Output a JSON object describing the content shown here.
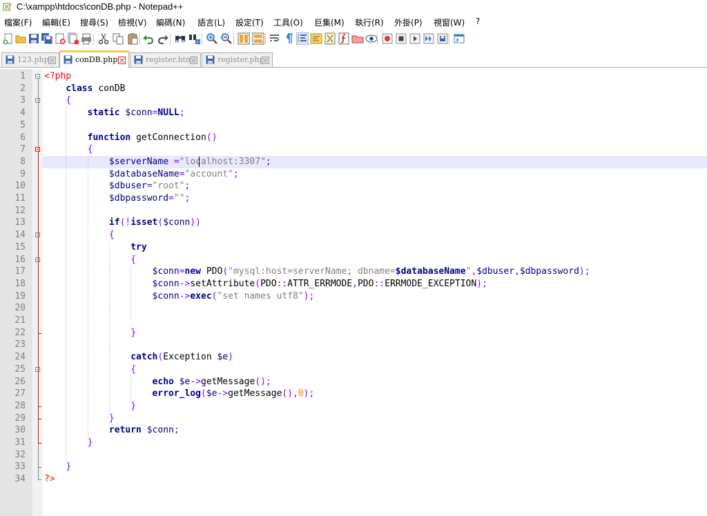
{
  "window": {
    "title": "C:\\xampp\\htdocs\\conDB.php - Notepad++"
  },
  "menu": [
    "檔案(F)",
    "編輯(E)",
    "搜尋(S)",
    "檢視(V)",
    "編碼(N)",
    "語言(L)",
    "設定(T)",
    "工具(O)",
    "巨集(M)",
    "執行(R)",
    "外掛(P)",
    "視窗(W)",
    "?"
  ],
  "toolbar": {
    "buttons": [
      "new-file",
      "open-file",
      "save",
      "save-all",
      "close",
      "close-all",
      "print",
      "cut",
      "copy",
      "paste",
      "undo",
      "redo",
      "find",
      "replace",
      "zoom-in",
      "zoom-out",
      "sync-vertical",
      "sync-horizontal",
      "word-wrap",
      "show-all-characters",
      "indent-guide",
      "user-defined-language",
      "document-map",
      "function-list",
      "folder-as-workspace",
      "monitoring",
      "record-macro",
      "stop-recording",
      "playback-macro",
      "run-macro-multiple",
      "save-macro",
      "run"
    ]
  },
  "tabs": [
    {
      "label": "123.php",
      "active": false
    },
    {
      "label": "conDB.php",
      "active": true
    },
    {
      "label": "register.html",
      "active": false
    },
    {
      "label": "register.php",
      "active": false
    }
  ],
  "editor": {
    "current_line": 8,
    "colors": {
      "keyword": "#00008b",
      "variable": "#000080",
      "string": "#808080",
      "php_tag": "#ff0000",
      "operator": "#8000ff",
      "number": "#ff8000",
      "current_line_bg": "#e8e8ff",
      "gutter_bg": "#e4e4e4"
    },
    "lines": [
      {
        "n": "1",
        "segs": [
          [
            "php",
            "<?php"
          ]
        ]
      },
      {
        "n": "2",
        "segs": [
          [
            "t",
            "    "
          ],
          [
            "kw",
            "class"
          ],
          [
            "t",
            " conDB"
          ]
        ]
      },
      {
        "n": "3",
        "segs": [
          [
            "t",
            "    "
          ],
          [
            "op",
            "{"
          ]
        ]
      },
      {
        "n": "4",
        "segs": [
          [
            "t",
            "        "
          ],
          [
            "kw",
            "static"
          ],
          [
            "t",
            " "
          ],
          [
            "var",
            "$conn"
          ],
          [
            "op",
            "="
          ],
          [
            "kw",
            "NULL"
          ],
          [
            "op",
            ";"
          ]
        ]
      },
      {
        "n": "5",
        "segs": []
      },
      {
        "n": "6",
        "segs": [
          [
            "t",
            "        "
          ],
          [
            "kw",
            "function"
          ],
          [
            "t",
            " getConnection"
          ],
          [
            "op",
            "()"
          ]
        ]
      },
      {
        "n": "7",
        "segs": [
          [
            "t",
            "        "
          ],
          [
            "op",
            "{"
          ]
        ]
      },
      {
        "n": "8",
        "segs": [
          [
            "t",
            "            "
          ],
          [
            "var",
            "$serverName"
          ],
          [
            "t",
            " "
          ],
          [
            "op",
            "="
          ],
          [
            "str",
            "\"localhost:3307\""
          ],
          [
            "op",
            ";"
          ]
        ]
      },
      {
        "n": "9",
        "segs": [
          [
            "t",
            "            "
          ],
          [
            "var",
            "$databaseName"
          ],
          [
            "op",
            "="
          ],
          [
            "str",
            "\"account\""
          ],
          [
            "op",
            ";"
          ]
        ]
      },
      {
        "n": "10",
        "segs": [
          [
            "t",
            "            "
          ],
          [
            "var",
            "$dbuser"
          ],
          [
            "op",
            "="
          ],
          [
            "str",
            "\"root\""
          ],
          [
            "op",
            ";"
          ]
        ]
      },
      {
        "n": "11",
        "segs": [
          [
            "t",
            "            "
          ],
          [
            "var",
            "$dbpassword"
          ],
          [
            "op",
            "="
          ],
          [
            "str",
            "\"\""
          ],
          [
            "op",
            ";"
          ]
        ]
      },
      {
        "n": "12",
        "segs": []
      },
      {
        "n": "13",
        "segs": [
          [
            "t",
            "            "
          ],
          [
            "kw",
            "if"
          ],
          [
            "op",
            "(!"
          ],
          [
            "kw",
            "isset"
          ],
          [
            "op",
            "("
          ],
          [
            "var",
            "$conn"
          ],
          [
            "op",
            "))"
          ]
        ]
      },
      {
        "n": "14",
        "segs": [
          [
            "t",
            "            "
          ],
          [
            "op",
            "{"
          ]
        ]
      },
      {
        "n": "15",
        "segs": [
          [
            "t",
            "                "
          ],
          [
            "kw",
            "try"
          ]
        ]
      },
      {
        "n": "16",
        "segs": [
          [
            "t",
            "                "
          ],
          [
            "op",
            "{"
          ]
        ]
      },
      {
        "n": "17",
        "segs": [
          [
            "t",
            "                    "
          ],
          [
            "var",
            "$conn"
          ],
          [
            "op",
            "="
          ],
          [
            "kw",
            "new"
          ],
          [
            "t",
            " PDO"
          ],
          [
            "op",
            "("
          ],
          [
            "str",
            "\"mysql:host=serverName; dbname="
          ],
          [
            "dqb",
            "$databaseName"
          ],
          [
            "str",
            "\""
          ],
          [
            "op",
            ","
          ],
          [
            "var",
            "$dbuser"
          ],
          [
            "op",
            ","
          ],
          [
            "var",
            "$dbpassword"
          ],
          [
            "op",
            ");"
          ]
        ]
      },
      {
        "n": "18",
        "segs": [
          [
            "t",
            "                    "
          ],
          [
            "var",
            "$conn"
          ],
          [
            "op",
            "->"
          ],
          [
            "t",
            "setAttribute"
          ],
          [
            "op",
            "("
          ],
          [
            "t",
            "PDO"
          ],
          [
            "op",
            "::"
          ],
          [
            "t",
            "ATTR_ERRMODE"
          ],
          [
            "op",
            ","
          ],
          [
            "t",
            "PDO"
          ],
          [
            "op",
            "::"
          ],
          [
            "t",
            "ERRMODE_EXCEPTION"
          ],
          [
            "op",
            ");"
          ]
        ]
      },
      {
        "n": "19",
        "segs": [
          [
            "t",
            "                    "
          ],
          [
            "var",
            "$conn"
          ],
          [
            "op",
            "->"
          ],
          [
            "kw",
            "exec"
          ],
          [
            "op",
            "("
          ],
          [
            "str",
            "\"set names utf8\""
          ],
          [
            "op",
            ");"
          ]
        ]
      },
      {
        "n": "20",
        "segs": []
      },
      {
        "n": "21",
        "segs": []
      },
      {
        "n": "22",
        "segs": [
          [
            "t",
            "                "
          ],
          [
            "op",
            "}"
          ]
        ]
      },
      {
        "n": "23",
        "segs": []
      },
      {
        "n": "24",
        "segs": [
          [
            "t",
            "                "
          ],
          [
            "kw",
            "catch"
          ],
          [
            "op",
            "("
          ],
          [
            "t",
            "Exception "
          ],
          [
            "var",
            "$e"
          ],
          [
            "op",
            ")"
          ]
        ]
      },
      {
        "n": "25",
        "segs": [
          [
            "t",
            "                "
          ],
          [
            "op",
            "{"
          ]
        ]
      },
      {
        "n": "26",
        "segs": [
          [
            "t",
            "                    "
          ],
          [
            "kw",
            "echo"
          ],
          [
            "t",
            " "
          ],
          [
            "var",
            "$e"
          ],
          [
            "op",
            "->"
          ],
          [
            "t",
            "getMessage"
          ],
          [
            "op",
            "();"
          ]
        ]
      },
      {
        "n": "27",
        "segs": [
          [
            "t",
            "                    "
          ],
          [
            "kw",
            "error_log"
          ],
          [
            "op",
            "("
          ],
          [
            "var",
            "$e"
          ],
          [
            "op",
            "->"
          ],
          [
            "t",
            "getMessage"
          ],
          [
            "op",
            "(),"
          ],
          [
            "num",
            "0"
          ],
          [
            "op",
            ");"
          ]
        ]
      },
      {
        "n": "28",
        "segs": [
          [
            "t",
            "                "
          ],
          [
            "op",
            "}"
          ]
        ]
      },
      {
        "n": "29",
        "segs": [
          [
            "t",
            "            "
          ],
          [
            "op",
            "}"
          ]
        ]
      },
      {
        "n": "30",
        "segs": [
          [
            "t",
            "            "
          ],
          [
            "kw",
            "return"
          ],
          [
            "t",
            " "
          ],
          [
            "var",
            "$conn"
          ],
          [
            "op",
            ";"
          ]
        ]
      },
      {
        "n": "31",
        "segs": [
          [
            "t",
            "        "
          ],
          [
            "op",
            "}"
          ]
        ]
      },
      {
        "n": "32",
        "segs": []
      },
      {
        "n": "33",
        "segs": [
          [
            "t",
            "    "
          ],
          [
            "op",
            "}"
          ]
        ]
      },
      {
        "n": "34",
        "segs": [
          [
            "php",
            "?>"
          ]
        ]
      }
    ]
  }
}
